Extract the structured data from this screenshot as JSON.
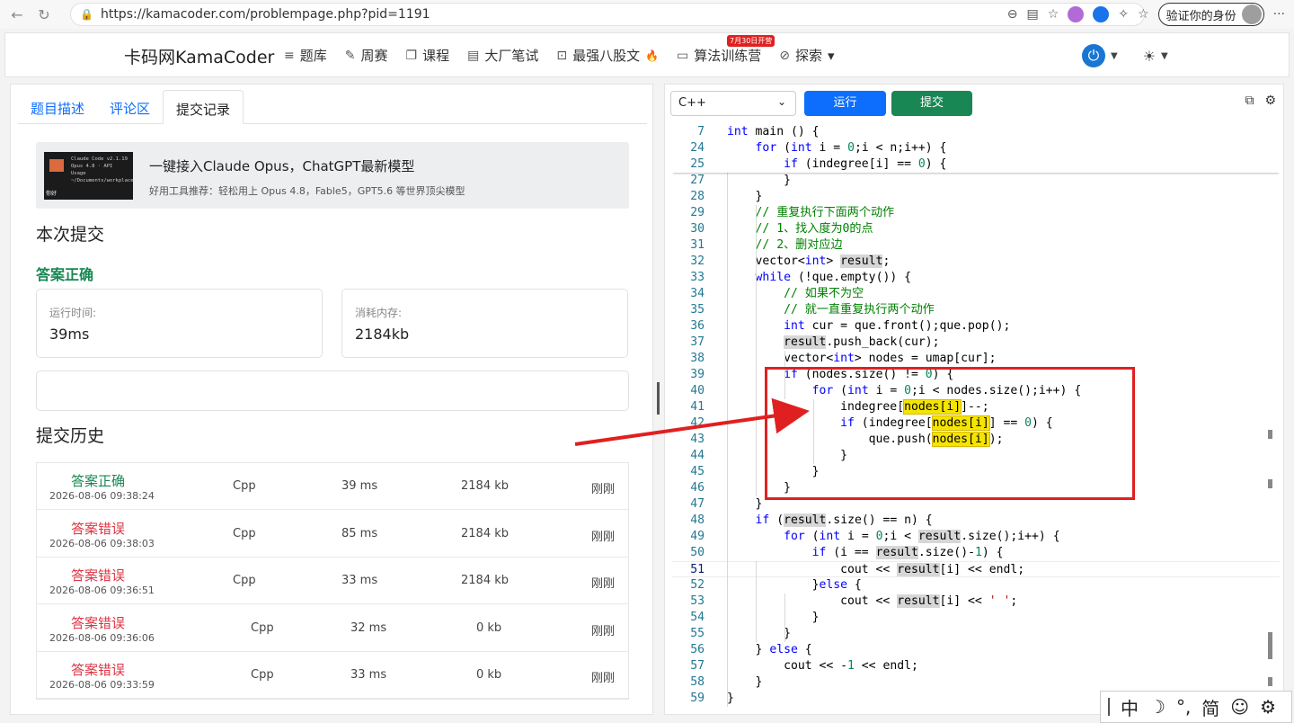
{
  "browser": {
    "url": "https://kamacoder.com/problempage.php?pid=1191",
    "profile_label": "验证你的身份",
    "more": "···"
  },
  "header": {
    "brand": "卡码网KamaCoder",
    "menu": [
      {
        "icon": "list-icon",
        "label": "题库"
      },
      {
        "icon": "pencil-icon",
        "label": "周赛"
      },
      {
        "icon": "copy-icon",
        "label": "课程"
      },
      {
        "icon": "document-icon",
        "label": "大厂笔试"
      },
      {
        "icon": "bracket-icon",
        "label": "最强八股文"
      },
      {
        "icon": "calendar-icon",
        "label": "算法训练营",
        "badge": "7月30日开营"
      },
      {
        "icon": "compass-icon",
        "label": "探索"
      }
    ]
  },
  "left": {
    "tabs": [
      "题目描述",
      "评论区",
      "提交记录"
    ],
    "active_tab": "提交记录",
    "ad": {
      "title": "一键接入Claude Opus，ChatGPT最新模型",
      "subtitle": "好用工具推荐：轻松用上 Opus 4.8，Fable5，GPT5.6 等世界顶尖模型",
      "img_line1": "Claude Code v2.1.19",
      "img_line2": "Opus 4.8 · API Usage",
      "img_line3": "~/Documents/workplace",
      "img_hi": "你好"
    },
    "this_submission": "本次提交",
    "result": "答案正确",
    "runtime_label": "运行时间:",
    "runtime": "39ms",
    "memory_label": "消耗内存:",
    "memory": "2184kb",
    "history_title": "提交历史",
    "history": [
      {
        "status": "答案正确",
        "ok": true,
        "date": "2026-08-06 09:38:24",
        "lang": "Cpp",
        "time": "39 ms",
        "mem": "2184 kb",
        "when": "刚刚"
      },
      {
        "status": "答案错误",
        "ok": false,
        "date": "2026-08-06 09:38:03",
        "lang": "Cpp",
        "time": "85 ms",
        "mem": "2184 kb",
        "when": "刚刚"
      },
      {
        "status": "答案错误",
        "ok": false,
        "date": "2026-08-06 09:36:51",
        "lang": "Cpp",
        "time": "33 ms",
        "mem": "2184 kb",
        "when": "刚刚"
      },
      {
        "status": "答案错误",
        "ok": false,
        "date": "2026-08-06 09:36:06",
        "lang": "Cpp",
        "time": "32 ms",
        "mem": "0 kb",
        "when": "刚刚"
      },
      {
        "status": "答案错误",
        "ok": false,
        "date": "2026-08-06 09:33:59",
        "lang": "Cpp",
        "time": "33 ms",
        "mem": "0 kb",
        "when": "刚刚"
      }
    ]
  },
  "right": {
    "language": "C++",
    "run_label": "运行",
    "submit_label": "提交",
    "code_lines": [
      {
        "n": "7",
        "t": "<span class='kw'>int</span> main () {"
      },
      {
        "n": "24",
        "t": "    <span class='kw'>for</span> (<span class='kw'>int</span> i = <span class='nm'>0</span>;i &lt; n;i++) {"
      },
      {
        "n": "25",
        "t": "        <span class='kw'>if</span> (indegree[i] == <span class='nm'>0</span>) {"
      },
      {
        "n": "27",
        "t": "        }"
      },
      {
        "n": "28",
        "t": "    }"
      },
      {
        "n": "29",
        "t": "    <span class='cm'>// 重复执行下面两个动作</span>"
      },
      {
        "n": "30",
        "t": "    <span class='cm'>// 1、找入度为0的点</span>"
      },
      {
        "n": "31",
        "t": "    <span class='cm'>// 2、删对应边</span>"
      },
      {
        "n": "32",
        "t": "    vector&lt;<span class='kw'>int</span>&gt; <span class='hl'>result</span>;"
      },
      {
        "n": "33",
        "t": "    <span class='kw'>while</span> (!que.empty()) {"
      },
      {
        "n": "34",
        "t": "        <span class='cm'>// 如果不为空</span>"
      },
      {
        "n": "35",
        "t": "        <span class='cm'>// 就一直重复执行两个动作</span>"
      },
      {
        "n": "36",
        "t": "        <span class='kw'>int</span> cur = que.front();que.pop();"
      },
      {
        "n": "37",
        "t": "        <span class='hl'>result</span>.push_back(cur);"
      },
      {
        "n": "38",
        "t": "        vector&lt;<span class='kw'>int</span>&gt; nodes = umap[cur];"
      },
      {
        "n": "39",
        "t": "        <span class='kw'>if</span> (nodes.size() != <span class='nm'>0</span>) {"
      },
      {
        "n": "40",
        "t": "            <span class='kw'>for</span> (<span class='kw'>int</span> i = <span class='nm'>0</span>;i &lt; nodes.size();i++) {"
      },
      {
        "n": "41",
        "t": "                indegree[<span class='yl'>nodes[i]</span>]--;"
      },
      {
        "n": "42",
        "t": "                <span class='kw'>if</span> (indegree[<span class='yl'>nodes[i]</span>] == <span class='nm'>0</span>) {"
      },
      {
        "n": "43",
        "t": "                    que.push(<span class='yl'>nodes[i]</span>);"
      },
      {
        "n": "44",
        "t": "                }"
      },
      {
        "n": "45",
        "t": "            }"
      },
      {
        "n": "46",
        "t": "        }"
      },
      {
        "n": "47",
        "t": "    }"
      },
      {
        "n": "48",
        "t": "    <span class='kw'>if</span> (<span class='hl'>result</span>.size() == n) {"
      },
      {
        "n": "49",
        "t": "        <span class='kw'>for</span> (<span class='kw'>int</span> i = <span class='nm'>0</span>;i &lt; <span class='hl'>result</span>.size();i++) {"
      },
      {
        "n": "50",
        "t": "            <span class='kw'>if</span> (i == <span class='hl'>result</span>.size()-<span class='nm'>1</span>) {"
      },
      {
        "n": "51",
        "t": "                cout &lt;&lt; <span class='hl'>result</span>[i] &lt;&lt; endl;"
      },
      {
        "n": "52",
        "t": "            }<span class='kw'>else</span> {"
      },
      {
        "n": "53",
        "t": "                cout &lt;&lt; <span class='hl'>result</span>[i] &lt;&lt; <span class='str'>' '</span>;"
      },
      {
        "n": "54",
        "t": "            }"
      },
      {
        "n": "55",
        "t": "        }"
      },
      {
        "n": "56",
        "t": "    } <span class='kw'>else</span> {"
      },
      {
        "n": "57",
        "t": "        cout &lt;&lt; -<span class='nm'>1</span> &lt;&lt; endl;"
      },
      {
        "n": "58",
        "t": "    }"
      },
      {
        "n": "59",
        "t": "}"
      }
    ]
  },
  "ime": [
    "中",
    "☽",
    "°,",
    "简",
    "☺",
    "⚙"
  ]
}
